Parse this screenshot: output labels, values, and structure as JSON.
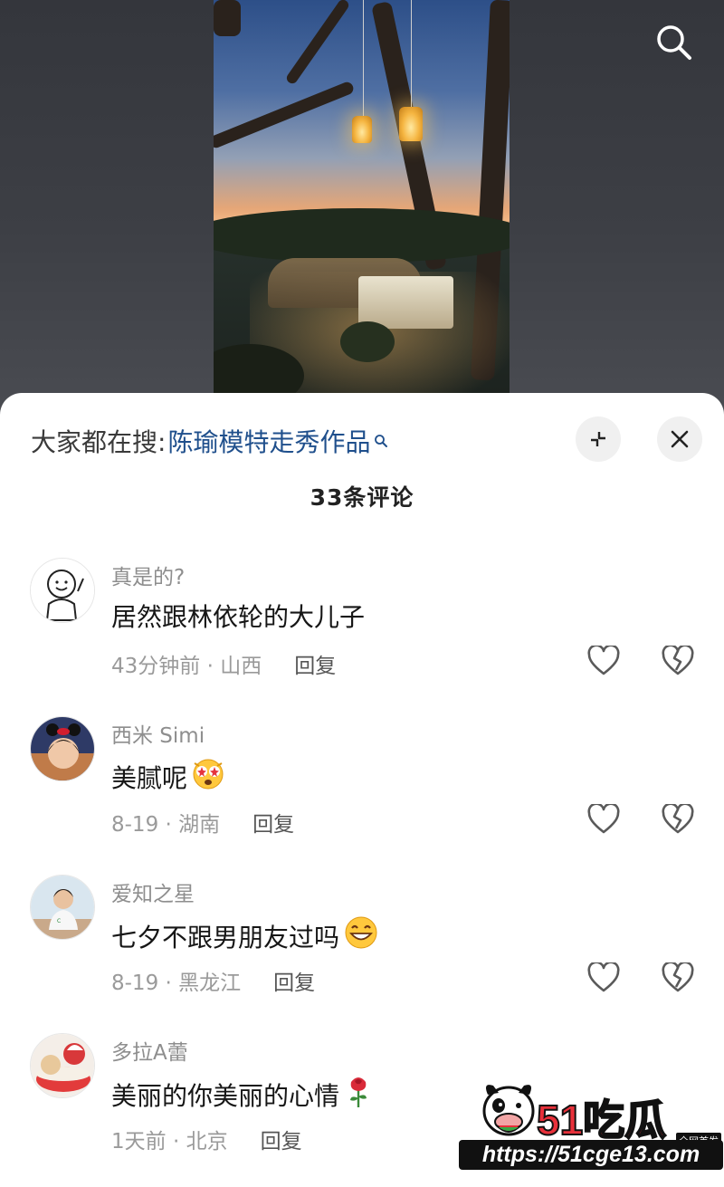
{
  "hot_search": {
    "prefix": "大家都在搜:",
    "keyword": "陈瑜模特走秀作品"
  },
  "comments_count": "33条评论",
  "comments": [
    {
      "username": "真是的?",
      "text": "居然跟林依轮的大儿子",
      "time_location": "43分钟前 · 山西",
      "reply": "回复",
      "emoji": ""
    },
    {
      "username": "西米 Simi",
      "text": "美腻呢",
      "time_location": "8-19 · 湖南",
      "reply": "回复",
      "emoji": "starry-eyes-face-emoji"
    },
    {
      "username": "爱知之星",
      "text": "七夕不跟男朋友过吗",
      "time_location": "8-19 · 黑龙江",
      "reply": "回复",
      "emoji": "grinning-face-emoji"
    },
    {
      "username": "多拉A蕾",
      "text": "美丽的你美丽的心情",
      "time_location": "1天前 · 北京",
      "reply": "回复",
      "emoji": "rose-emoji"
    }
  ],
  "watermark": {
    "title": "51吃瓜",
    "badge": "全网首发",
    "url": "https://51cge13.com"
  },
  "colors": {
    "keyword": "#1f4f8c",
    "sheet_bg": "#ffffff",
    "video_bg": "#3a3c42",
    "watermark_red": "#e8303a"
  },
  "icons": [
    "search-icon",
    "collapse-icon",
    "close-icon",
    "heart-icon",
    "broken-heart-icon"
  ]
}
